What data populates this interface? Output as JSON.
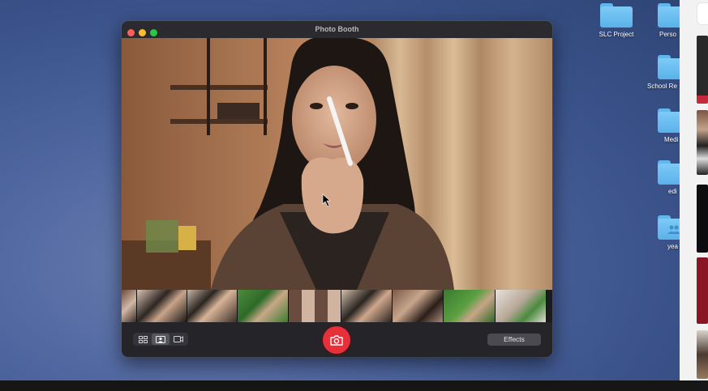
{
  "window": {
    "title": "Photo Booth"
  },
  "toolbar": {
    "effects_label": "Effects"
  },
  "desktop_items": [
    {
      "label": "SLC Project",
      "glyph": ""
    },
    {
      "label": "Perso",
      "glyph": ""
    },
    {
      "label": "School Re",
      "glyph": ""
    },
    {
      "label": "Medi",
      "glyph": ""
    },
    {
      "label": "edi",
      "glyph": ""
    },
    {
      "label": "yea",
      "glyph": "people"
    }
  ],
  "colors": {
    "shutter": "#e8303b",
    "folder": "#6cc0f2",
    "window_bg": "#252529"
  },
  "icons": {
    "grid_view": "grid-icon",
    "single_photo": "portrait-icon",
    "video": "video-camera-icon",
    "shutter": "camera-icon"
  }
}
